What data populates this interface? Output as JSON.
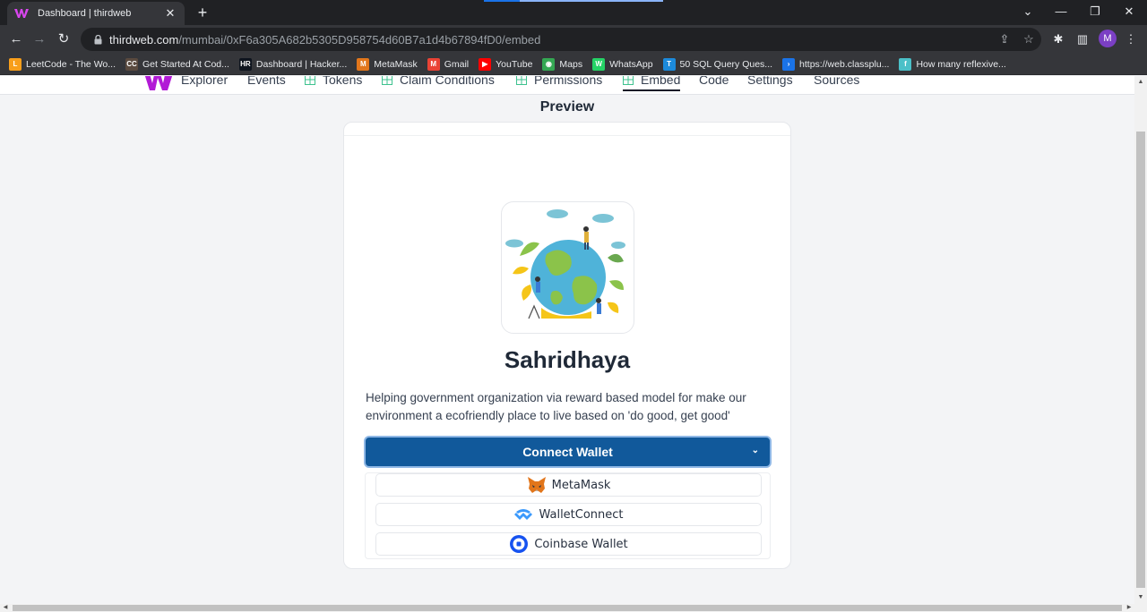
{
  "browser": {
    "tab_title": "Dashboard | thirdweb",
    "url_host": "thirdweb.com",
    "url_path": "/mumbai/0xF6a305A682b5305D958754d60B7a1d4b67894fD0/embed",
    "profile_initial": "M"
  },
  "bookmarks": [
    {
      "label": "LeetCode - The Wo...",
      "icon": "leetcode-icon",
      "color": "#f89f1b"
    },
    {
      "label": "Get Started At Cod...",
      "icon": "codechef-icon",
      "color": "#5a4a3f"
    },
    {
      "label": "Dashboard | Hacker...",
      "icon": "hackerrank-icon",
      "color": "#0e141e"
    },
    {
      "label": "MetaMask",
      "icon": "metamask-icon",
      "color": "#e2761b"
    },
    {
      "label": "Gmail",
      "icon": "gmail-icon",
      "color": "#ea4335"
    },
    {
      "label": "YouTube",
      "icon": "youtube-icon",
      "color": "#ff0000"
    },
    {
      "label": "Maps",
      "icon": "maps-icon",
      "color": "#34a853"
    },
    {
      "label": "WhatsApp",
      "icon": "whatsapp-icon",
      "color": "#25d366"
    },
    {
      "label": "50 SQL Query Ques...",
      "icon": "techbeamers-icon",
      "color": "#1c8adb"
    },
    {
      "label": "https://web.classplu...",
      "icon": "classplus-icon",
      "color": "#1a73e8"
    },
    {
      "label": "How many reflexive...",
      "icon": "quizlet-icon",
      "color": "#4bc0c8"
    }
  ],
  "subnav": {
    "items": [
      "Explorer",
      "Events",
      "Tokens",
      "Claim Conditions",
      "Permissions",
      "Embed",
      "Code",
      "Settings",
      "Sources"
    ],
    "active": "Embed"
  },
  "preview": {
    "title": "Preview",
    "contract_name": "Sahridhaya",
    "description": "Helping government organization via reward based model for make our environment a ecofriendly place to live based on 'do good, get good'",
    "connect_label": "Connect Wallet",
    "wallets": [
      "MetaMask",
      "WalletConnect",
      "Coinbase Wallet"
    ]
  },
  "colors": {
    "connect_button": "#11599b",
    "accent_green": "#3ec28f"
  }
}
